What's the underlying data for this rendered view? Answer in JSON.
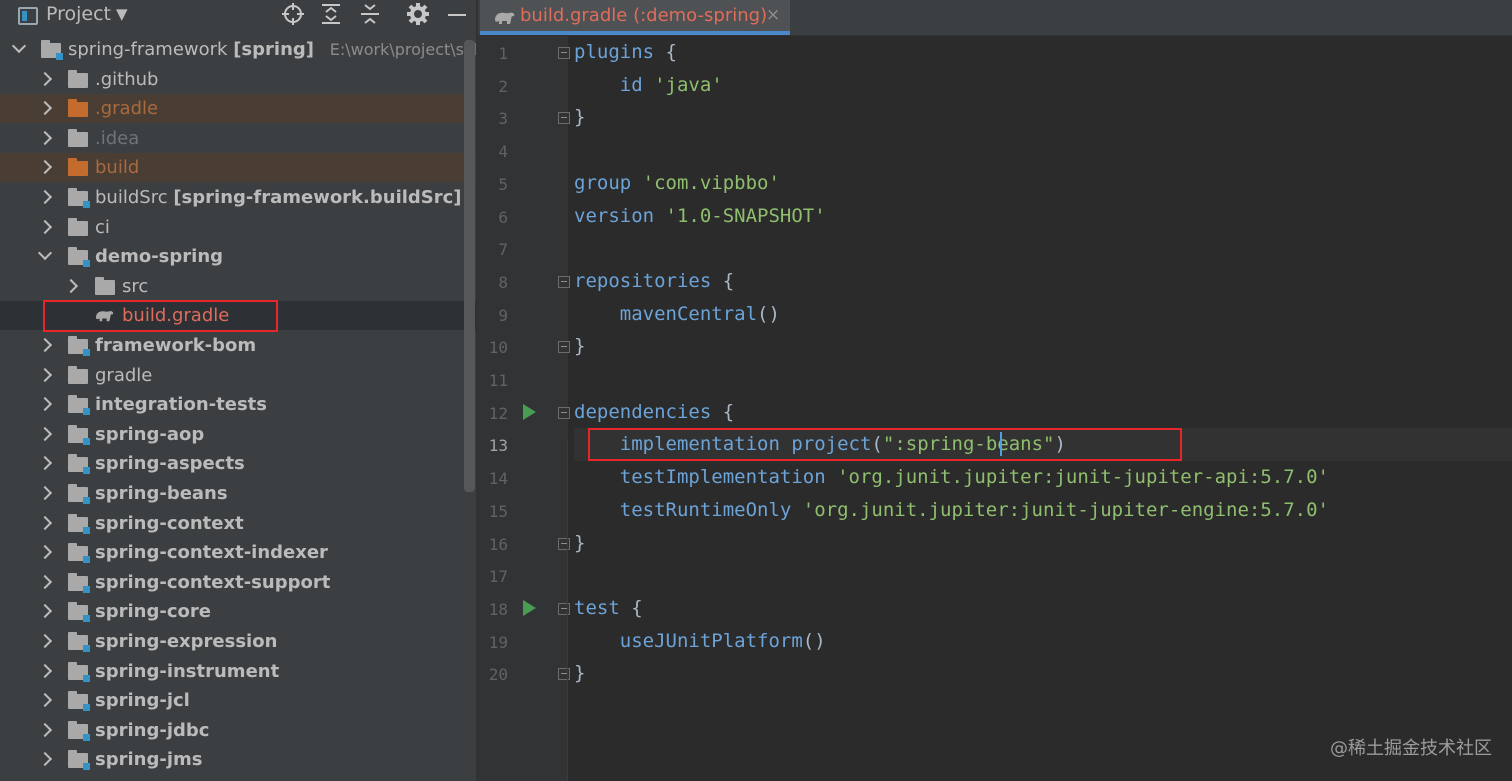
{
  "panel": {
    "title": "Project",
    "dropdown_icon": "chevron-down-icon",
    "toolbar_icons": [
      "locate-icon",
      "expand-all-icon",
      "collapse-all-icon",
      "gear-icon",
      "minimize-icon"
    ]
  },
  "tree": {
    "root": {
      "label": "spring-framework",
      "module": "[spring]",
      "path": "E:\\work\\project\\self\\"
    },
    "items": [
      {
        "label": ".github"
      },
      {
        "label": ".gradle"
      },
      {
        "label": ".idea"
      },
      {
        "label": "build"
      },
      {
        "label": "buildSrc",
        "suffix": "[spring-framework.buildSrc]"
      },
      {
        "label": "ci"
      },
      {
        "label": "demo-spring"
      },
      {
        "label": "src"
      },
      {
        "label": "build.gradle"
      },
      {
        "label": "framework-bom"
      },
      {
        "label": "gradle"
      },
      {
        "label": "integration-tests"
      },
      {
        "label": "spring-aop"
      },
      {
        "label": "spring-aspects"
      },
      {
        "label": "spring-beans"
      },
      {
        "label": "spring-context"
      },
      {
        "label": "spring-context-indexer"
      },
      {
        "label": "spring-context-support"
      },
      {
        "label": "spring-core"
      },
      {
        "label": "spring-expression"
      },
      {
        "label": "spring-instrument"
      },
      {
        "label": "spring-jcl"
      },
      {
        "label": "spring-jdbc"
      },
      {
        "label": "spring-jms"
      }
    ]
  },
  "editor": {
    "tab": {
      "label": "build.gradle (:demo-spring)",
      "close": "×",
      "icon": "gradle-elephant-icon"
    },
    "line_numbers": [
      "1",
      "2",
      "3",
      "4",
      "5",
      "6",
      "7",
      "8",
      "9",
      "10",
      "11",
      "12",
      "13",
      "14",
      "15",
      "16",
      "17",
      "18",
      "19",
      "20"
    ],
    "current_line": 13,
    "lines": [
      [
        {
          "t": "plugins",
          "c": "fn"
        },
        {
          "t": " {",
          "c": "plain"
        }
      ],
      [
        {
          "t": "    id",
          "c": "fn"
        },
        {
          "t": " 'java'",
          "c": "str"
        }
      ],
      [
        {
          "t": "}",
          "c": "plain"
        }
      ],
      [],
      [
        {
          "t": "group",
          "c": "fn"
        },
        {
          "t": " 'com.vipbbo'",
          "c": "str"
        }
      ],
      [
        {
          "t": "version",
          "c": "fn"
        },
        {
          "t": " '1.0-SNAPSHOT'",
          "c": "str"
        }
      ],
      [],
      [
        {
          "t": "repositories",
          "c": "fn"
        },
        {
          "t": " {",
          "c": "plain"
        }
      ],
      [
        {
          "t": "    mavenCentral",
          "c": "fn"
        },
        {
          "t": "()",
          "c": "plain"
        }
      ],
      [
        {
          "t": "}",
          "c": "plain"
        }
      ],
      [],
      [
        {
          "t": "dependencies",
          "c": "fn"
        },
        {
          "t": " {",
          "c": "plain"
        }
      ],
      [
        {
          "t": "    implementation project",
          "c": "fn"
        },
        {
          "t": "(",
          "c": "plain"
        },
        {
          "t": "\":spring-beans\"",
          "c": "str"
        },
        {
          "t": ")",
          "c": "plain"
        }
      ],
      [
        {
          "t": "    testImplementation",
          "c": "fn"
        },
        {
          "t": " 'org.junit.jupiter:junit-jupiter-api:5.7.0'",
          "c": "str"
        }
      ],
      [
        {
          "t": "    testRuntimeOnly",
          "c": "fn"
        },
        {
          "t": " 'org.junit.jupiter:junit-jupiter-engine:5.7.0'",
          "c": "str"
        }
      ],
      [
        {
          "t": "}",
          "c": "plain"
        }
      ],
      [],
      [
        {
          "t": "test",
          "c": "fn"
        },
        {
          "t": " {",
          "c": "plain"
        }
      ],
      [
        {
          "t": "    useJUnitPlatform",
          "c": "fn"
        },
        {
          "t": "()",
          "c": "plain"
        }
      ],
      [
        {
          "t": "}",
          "c": "plain"
        }
      ]
    ]
  },
  "watermark": "@稀土掘金技术社区"
}
